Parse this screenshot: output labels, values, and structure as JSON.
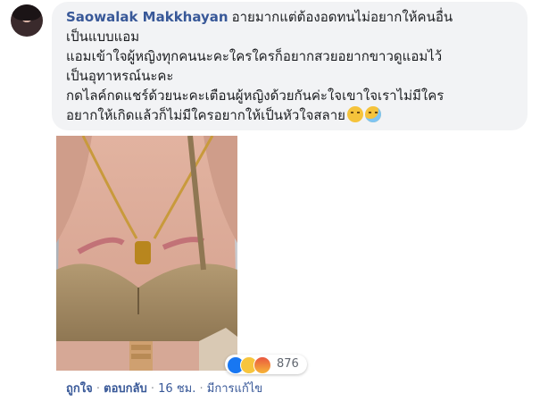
{
  "comment": {
    "author": "Saowalak Makkhayan",
    "lines": [
      "อายมากแต่ต้องอดทนไม่อยากให้คนอื่น",
      "เป็นแบบแอม",
      "แอมเข้าใจผู้หญิงทุกคนนะคะใครใครก็อยากสวยอยากขาวดูแอมไว้",
      "เป็นอุทาหรณ์นะคะ",
      "กดไลค์กดแชร์ด้วยนะคะเตือนผู้หญิงด้วยกันค่ะใจเขาใจเราไม่มีใคร",
      "อยากให้เกิดแล้วก็ไม่มีใครอยากให้เป็นหัวใจสลาย"
    ],
    "emojis": [
      "disappointed-face",
      "crying-face"
    ]
  },
  "reactions": {
    "types": [
      "like",
      "sad",
      "angry"
    ],
    "count": "876"
  },
  "actions": {
    "like": "ถูกใจ",
    "sep1": "·",
    "reply": "ตอบกลับ",
    "sep2": "·",
    "time": "16 ชม.",
    "sep3": "·",
    "edited": "มีการแก้ไข"
  },
  "colors": {
    "author": "#385898",
    "bubble": "#f2f3f5",
    "like": "#1877f2"
  }
}
